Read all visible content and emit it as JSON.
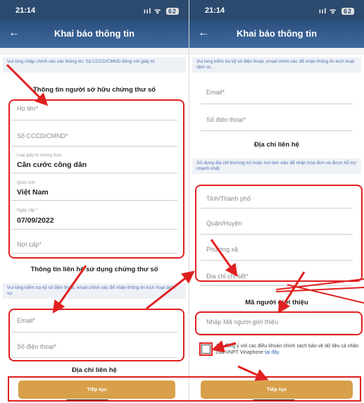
{
  "left": {
    "status": {
      "time": "21:14",
      "signal": "ııl ᯤ",
      "battery": "62"
    },
    "appbar": {
      "back_glyph": "←",
      "title": "Khai báo thông tin"
    },
    "note_top": "Vui lòng nhập chính xác các thông tin: Số CCCD/CMND đúng với giấy tờ",
    "owner_title": "Thông tin người sở hữu chứng thư số",
    "fields": {
      "fullname": "Họ tên*",
      "id_number": "Số CCCD/CMND*",
      "doc_type_label": "Loại giấy tờ chứng thực",
      "doc_type_value": "Căn cước công dân",
      "nationality_label": "Quốc tịch",
      "nationality_value": "Việt Nam",
      "issue_date_label": "Ngày cấp *",
      "issue_date_value": "07/09/2022",
      "issue_place": "Nơi cấp*"
    },
    "contact_title": "Thông tin liên hệ sử dụng chứng thư số",
    "note_contact": "Vui lòng kiểm tra kỹ số điện thoại, email chính xác để nhận thông tin kích hoạt dịch vụ.",
    "email": "Email*",
    "phone": "Số điện thoại*",
    "address_title": "Địa chỉ liên hệ",
    "continue_label": "Tiếp tục"
  },
  "right": {
    "status": {
      "time": "21:14",
      "signal": "ııl ᯤ",
      "battery": "62"
    },
    "appbar": {
      "back_glyph": "←",
      "title": "Khai báo thông tin"
    },
    "note_top": "Vui lòng kiểm tra kỹ số điện thoại, email chính xác để nhận thông tin kích hoạt dịch vụ.",
    "email": "Email*",
    "phone": "Số điện thoại*",
    "address_title": "Địa chỉ liên hệ",
    "note_address": "Sử dụng địa chỉ thường trú hoặc nơi làm việc để nhận hóa đơn và được hỗ trợ nhanh nhất.",
    "province": "Tỉnh/Thành phố",
    "district": "Quận/Huyện",
    "ward": "Phường xã",
    "detail_address": "Địa chỉ chi tiết*",
    "referrer_title": "Mã người giới thiệu",
    "referrer_input": "Nhập Mã người giới thiệu",
    "consent_text": "Tôi đồng ý với các điều khoản chính sách bảo vệ dữ liệu cá nhân của VNPT Vinaphone",
    "consent_link": "tại đây",
    "continue_label": "Tiếp tục"
  },
  "colors": {
    "annotation": "#e02020",
    "button": "#d8a04a",
    "appbar": "#3f6aa0"
  },
  "icons": [
    "back-arrow-icon",
    "signal-icon",
    "wifi-icon",
    "battery-icon",
    "checkbox-icon"
  ]
}
